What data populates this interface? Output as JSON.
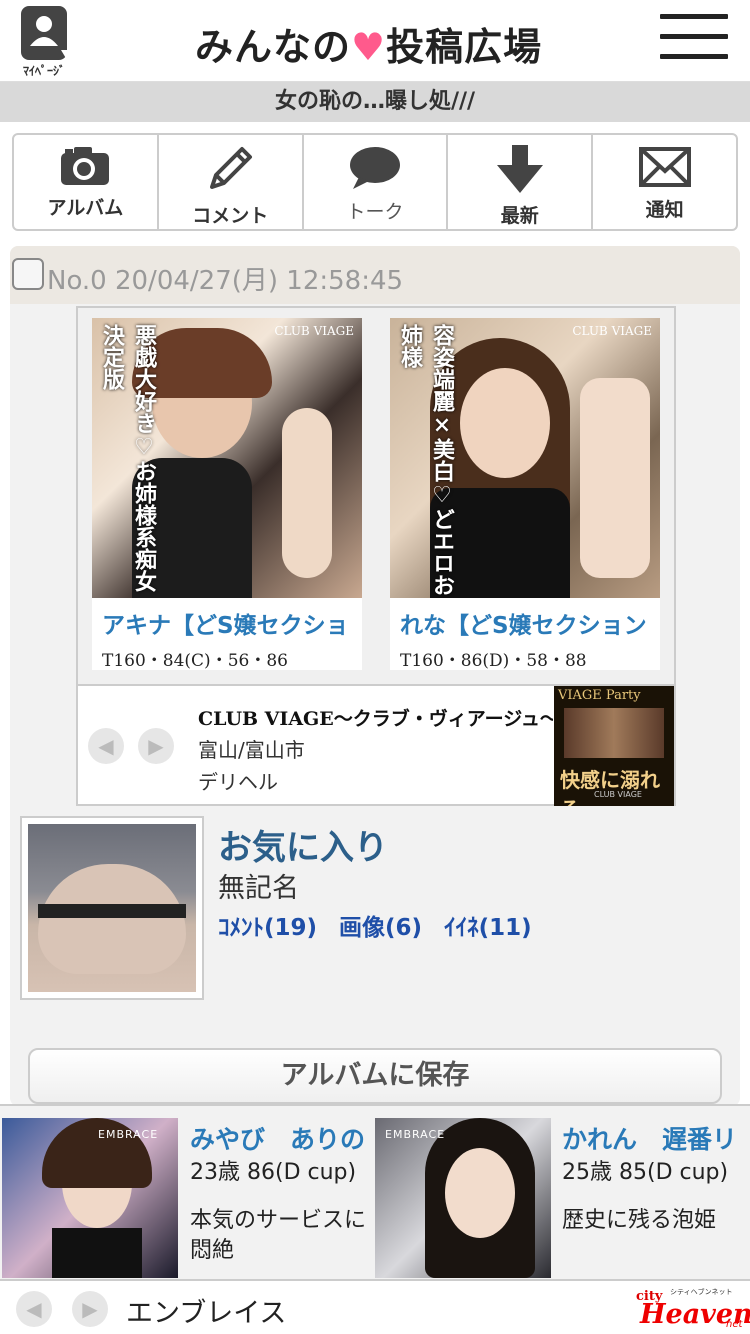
{
  "header": {
    "mypage_label": "ﾏｲﾍﾟｰｼﾞ",
    "logo_part1": "みんなの",
    "logo_heart": "♥",
    "logo_part2": "投稿広場"
  },
  "board_title": "女の恥の…曝し処///",
  "nav": [
    {
      "label": "アルバム",
      "icon": "camera-icon"
    },
    {
      "label": "コメント",
      "icon": "pencil-icon"
    },
    {
      "label": "トーク",
      "icon": "speech-bubble-icon"
    },
    {
      "label": "最新",
      "icon": "down-arrow-icon"
    },
    {
      "label": "通知",
      "icon": "envelope-icon"
    }
  ],
  "post": {
    "number_date": "No.0 20/04/27(月) 12:58:45",
    "ad": {
      "girls": [
        {
          "name": "アキナ【どS嬢セクショ",
          "spec": "T160・84(C)・56・86",
          "catch": "悪戯大好き♡お姉様系痴女決定版",
          "brand": "CLUB VIAGE"
        },
        {
          "name": "れな【どS嬢セクション",
          "spec": "T160・86(D)・58・88",
          "catch": "容姿端麗×美白♡どエロお姉様",
          "brand": "CLUB VIAGE"
        }
      ],
      "club_name": "CLUB VIAGE～クラブ・ヴィアージュ～",
      "area": "富山/富山市",
      "type": "デリヘル",
      "banner_title": "VIAGE Party",
      "banner_sub": "快感に溺れる",
      "banner_foot": "CLUB VIAGE"
    },
    "favorite": "お気に入り",
    "author": "無記名",
    "links": {
      "comment": "ｺﾒﾝﾄ(19)",
      "image": "画像(6)",
      "like": "ｲｲﾈ(11)"
    },
    "save_button": "アルバムに保存"
  },
  "bottom_ad": {
    "girls": [
      {
        "name": "みやび　ありの",
        "spec": "23歳 86(D cup)",
        "desc": "本気のサービスに悶絶"
      },
      {
        "name": "かれん　遅番リ",
        "spec": "25歳 85(D cup)",
        "desc": "歴史に残る泡姫"
      }
    ],
    "brand": "EMBRACE",
    "shop_name": "エンブレイス",
    "heaven_logo": "Heaven",
    "heaven_city": "city",
    "heaven_tag": "シティヘブンネット",
    "heaven_net": "net"
  }
}
